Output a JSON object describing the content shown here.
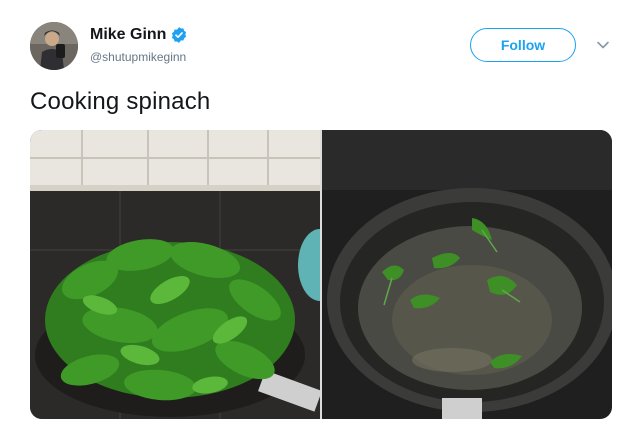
{
  "author": {
    "display_name": "Mike Ginn",
    "handle": "@shutupmikeginn",
    "verified": true,
    "avatar_icon": "profile-photo"
  },
  "actions": {
    "follow_label": "Follow",
    "more_icon": "chevron-down-icon"
  },
  "tweet": {
    "text": "Cooking spinach"
  },
  "media": {
    "photo_count": 2
  },
  "colors": {
    "brand": "#1da1f2",
    "name_text": "#14171a",
    "handle_text": "#657786"
  }
}
